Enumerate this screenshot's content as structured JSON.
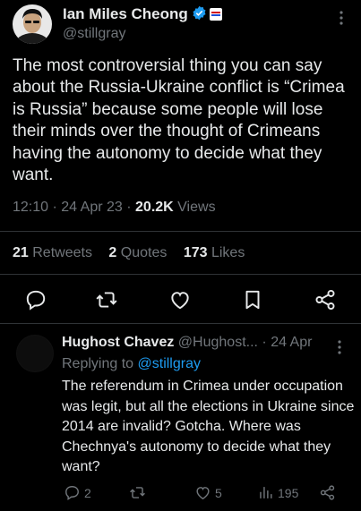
{
  "tweet": {
    "author_name": "Ian Miles Cheong",
    "author_handle": "@stillgray",
    "text": "The most controversial thing you can say about the Russia-Ukraine conflict is “Crimea is Russia” because some people will lose their minds over the thought of Crimeans having the autonomy to decide what they want.",
    "time": "12:10",
    "date": "24 Apr 23",
    "views_count": "20.2K",
    "views_label": "Views",
    "retweets_count": "21",
    "retweets_label": "Retweets",
    "quotes_count": "2",
    "quotes_label": "Quotes",
    "likes_count": "173",
    "likes_label": "Likes"
  },
  "reply": {
    "author_name": "Hughost Chavez",
    "author_handle": "@Hughost...",
    "date": "24 Apr",
    "replying_prefix": "Replying to",
    "replying_mention": "@stillgray",
    "text": "The referendum in Crimea under occupation was legit, but all the elections in Ukraine since 2014 are invalid? Gotcha. Where was Chechnya's autonomy to decide what they want?",
    "reply_count": "2",
    "like_count": "5",
    "view_count": "195"
  },
  "colors": {
    "background": "#000000",
    "text": "#e7e9ea",
    "secondary": "#71767b",
    "accent": "#1d9bf0",
    "divider": "#2f3336"
  }
}
